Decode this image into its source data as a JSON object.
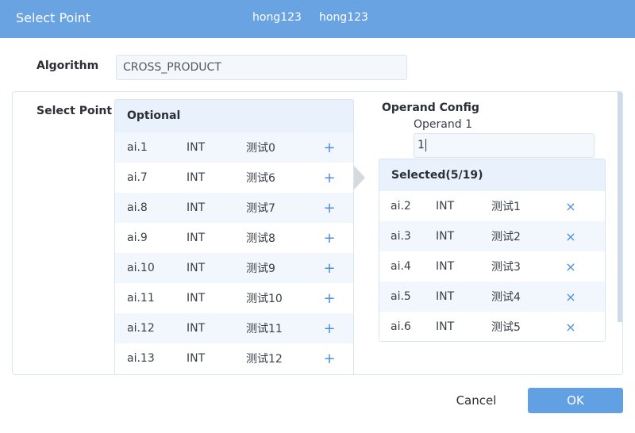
{
  "titlebar": {
    "title": "Select Point",
    "users": [
      "hong123",
      "hong123"
    ]
  },
  "algorithm": {
    "label": "Algorithm",
    "value": "CROSS_PRODUCT"
  },
  "select_point": {
    "label": "Select Point",
    "optional": {
      "title": "Optional",
      "add_icon": "+",
      "rows": [
        {
          "id": "ai.1",
          "type": "INT",
          "name": "测试0"
        },
        {
          "id": "ai.7",
          "type": "INT",
          "name": "测试6"
        },
        {
          "id": "ai.8",
          "type": "INT",
          "name": "测试7"
        },
        {
          "id": "ai.9",
          "type": "INT",
          "name": "测试8"
        },
        {
          "id": "ai.10",
          "type": "INT",
          "name": "测试9"
        },
        {
          "id": "ai.11",
          "type": "INT",
          "name": "测试10"
        },
        {
          "id": "ai.12",
          "type": "INT",
          "name": "测试11"
        },
        {
          "id": "ai.13",
          "type": "INT",
          "name": "测试12"
        }
      ]
    },
    "operand_config": {
      "title": "Operand Config",
      "operand1_label": "Operand 1",
      "operand1_value": "1"
    },
    "selected": {
      "title": "Selected(5/19)",
      "remove_icon": "×",
      "rows": [
        {
          "id": "ai.2",
          "type": "INT",
          "name": "测试1"
        },
        {
          "id": "ai.3",
          "type": "INT",
          "name": "测试2"
        },
        {
          "id": "ai.4",
          "type": "INT",
          "name": "测试3"
        },
        {
          "id": "ai.5",
          "type": "INT",
          "name": "测试4"
        },
        {
          "id": "ai.6",
          "type": "INT",
          "name": "测试5"
        }
      ]
    }
  },
  "footer": {
    "cancel_label": "Cancel",
    "ok_label": "OK"
  },
  "colors": {
    "accent": "#6aa3e2",
    "ok_button": "#62a0e4",
    "row_alt": "#f2f7fd",
    "header_bg": "#e8f1fc"
  }
}
